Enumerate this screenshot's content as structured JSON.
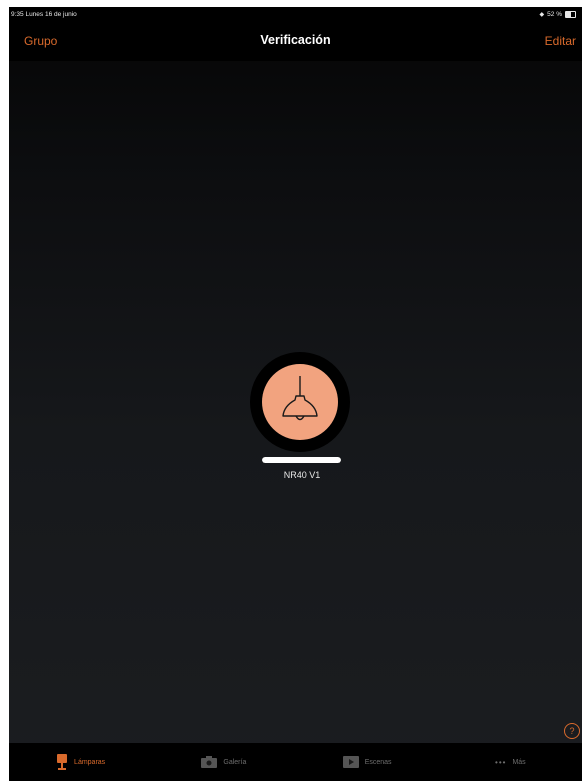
{
  "status_bar": {
    "time_date": "9:35  Lunes 16 de junio",
    "battery": "52 %",
    "battery_level": 0.52
  },
  "nav": {
    "left": "Grupo",
    "title": "Verificación",
    "right": "Editar"
  },
  "lamp": {
    "name": "NR40 V1",
    "level": 1.0,
    "icon": "pendant-lamp-icon"
  },
  "help": {
    "label": "?"
  },
  "tabs": [
    {
      "label": "Lámparas",
      "icon": "lamp-icon",
      "active": true
    },
    {
      "label": "Galería",
      "icon": "camera-icon",
      "active": false
    },
    {
      "label": "Escenas",
      "icon": "scene-play-icon",
      "active": false
    },
    {
      "label": "Más",
      "icon": "more-dots-icon",
      "active": false
    }
  ],
  "colors": {
    "accent": "#d96a2c",
    "lamp_fill": "#f2a37f",
    "background": "#16181b"
  }
}
